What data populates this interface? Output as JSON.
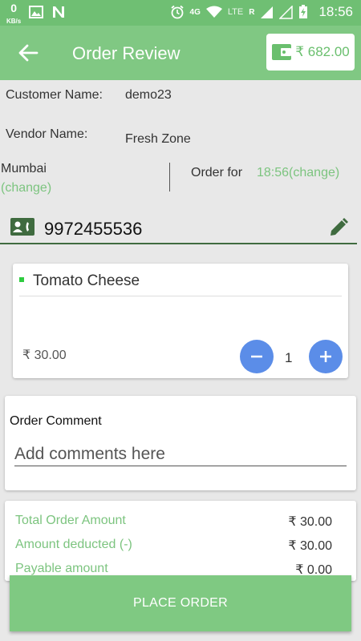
{
  "status_bar": {
    "speed_value": "0",
    "speed_unit": "KB/s",
    "network_4g": "4G",
    "network_lte": "LTE",
    "roaming": "R",
    "time": "18:56"
  },
  "app_bar": {
    "title": "Order Review",
    "wallet_amount": "₹ 682.00"
  },
  "order_info": {
    "customer_label": "Customer Name:",
    "customer_value": "demo23",
    "vendor_label": "Vendor Name:",
    "vendor_value": "Fresh Zone",
    "city": "Mumbai",
    "city_change": "(change)",
    "order_for_label": "Order for",
    "order_for_value": "18:56(change)"
  },
  "phone": {
    "value": "9972455536"
  },
  "item": {
    "name": "Tomato Cheese",
    "price": "₹ 30.00",
    "quantity": "1"
  },
  "comment": {
    "label": "Order Comment",
    "placeholder": "Add comments here"
  },
  "totals": [
    {
      "label": "Total Order Amount",
      "value": "₹ 30.00"
    },
    {
      "label": "Amount deducted (-)",
      "value": "₹ 30.00"
    },
    {
      "label": "Payable amount",
      "value": "₹ 0.00"
    }
  ],
  "place_order_label": "PLACE ORDER",
  "colors": {
    "status_bar": "#6fbf73",
    "app_bar": "#80c883",
    "accent_green": "#7cc47f",
    "qty_button": "#5b8de8",
    "place_button": "#7fc982"
  }
}
